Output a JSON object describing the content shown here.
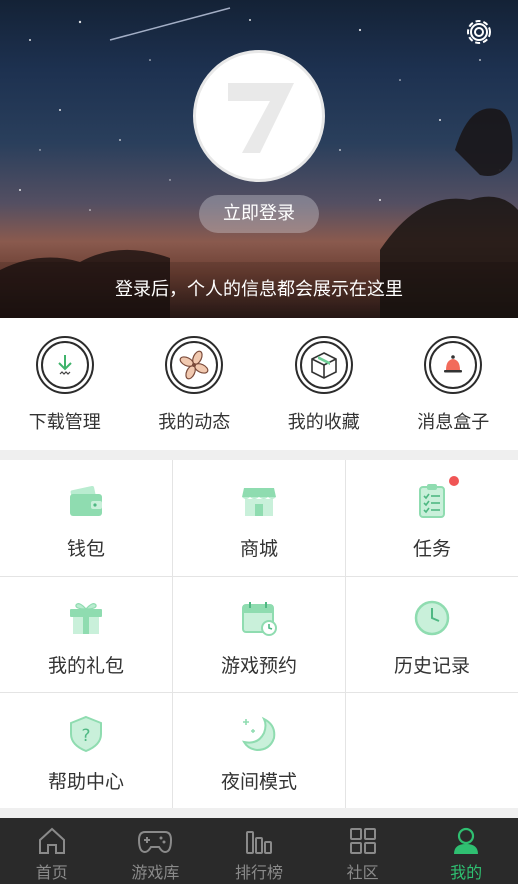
{
  "header": {
    "login_button": "立即登录",
    "tip": "登录后，个人的信息都会展示在这里",
    "settings_icon": "gear-icon",
    "avatar_icon": "logo-7-icon"
  },
  "quick_actions": [
    {
      "label": "下载管理",
      "icon": "download-icon"
    },
    {
      "label": "我的动态",
      "icon": "pinwheel-icon"
    },
    {
      "label": "我的收藏",
      "icon": "box-icon"
    },
    {
      "label": "消息盒子",
      "icon": "bell-icon"
    }
  ],
  "grid": [
    {
      "label": "钱包",
      "icon": "wallet-icon"
    },
    {
      "label": "商城",
      "icon": "store-icon"
    },
    {
      "label": "任务",
      "icon": "task-clipboard-icon",
      "badge": true
    },
    {
      "label": "我的礼包",
      "icon": "gift-icon"
    },
    {
      "label": "游戏预约",
      "icon": "calendar-icon"
    },
    {
      "label": "历史记录",
      "icon": "clock-icon"
    },
    {
      "label": "帮助中心",
      "icon": "help-shield-icon"
    },
    {
      "label": "夜间模式",
      "icon": "moon-icon"
    }
  ],
  "tabs": [
    {
      "label": "首页",
      "icon": "home-icon",
      "active": false
    },
    {
      "label": "游戏库",
      "icon": "gamepad-icon",
      "active": false
    },
    {
      "label": "排行榜",
      "icon": "ranking-icon",
      "active": false
    },
    {
      "label": "社区",
      "icon": "community-icon",
      "active": false
    },
    {
      "label": "我的",
      "icon": "profile-icon",
      "active": true
    }
  ],
  "colors": {
    "accent": "#2fbf71",
    "icon_green": "#8fdcb0",
    "badge": "#f05555",
    "tabbar_bg": "#2a2a2a"
  }
}
